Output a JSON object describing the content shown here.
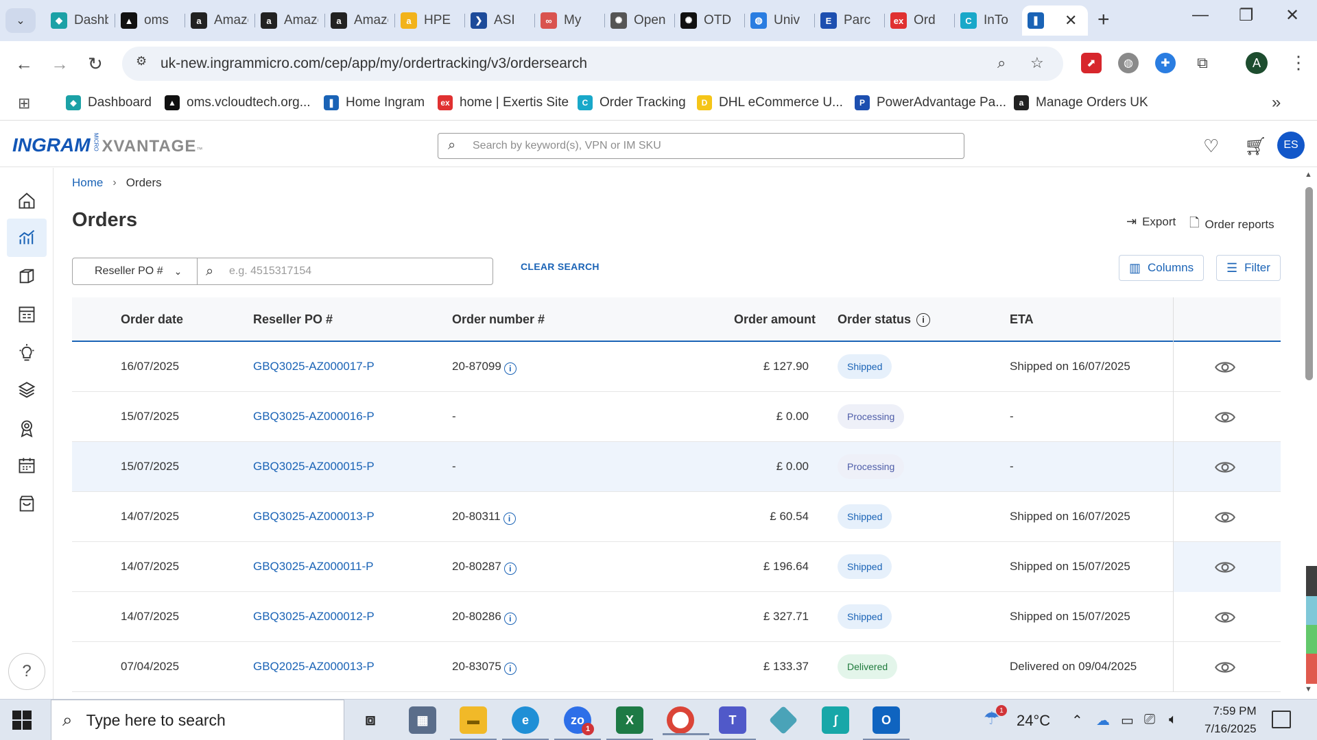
{
  "browser": {
    "tabs": [
      {
        "label": "Dashboard",
        "fav_color": "#1ba1a6",
        "fav_glyph": "◆"
      },
      {
        "label": "oms",
        "fav_color": "#111111",
        "fav_glyph": "▲"
      },
      {
        "label": "Amazon",
        "fav_color": "#222222",
        "fav_glyph": "a"
      },
      {
        "label": "Amazon",
        "fav_color": "#222222",
        "fav_glyph": "a"
      },
      {
        "label": "Amazon",
        "fav_color": "#222222",
        "fav_glyph": "a"
      },
      {
        "label": "HPE",
        "fav_color": "#f2b31b",
        "fav_glyph": "a"
      },
      {
        "label": "ASI",
        "fav_color": "#1d4b9a",
        "fav_glyph": "❯"
      },
      {
        "label": "My",
        "fav_color": "#d9534f",
        "fav_glyph": "∞"
      },
      {
        "label": "Open",
        "fav_color": "#555555",
        "fav_glyph": "✺"
      },
      {
        "label": "OTD",
        "fav_color": "#111111",
        "fav_glyph": "✺"
      },
      {
        "label": "Univ",
        "fav_color": "#2a7de1",
        "fav_glyph": "◍"
      },
      {
        "label": "Parc",
        "fav_color": "#1d4fb0",
        "fav_glyph": "E"
      },
      {
        "label": "Ord",
        "fav_color": "#e03131",
        "fav_glyph": "ex"
      },
      {
        "label": "InTo",
        "fav_color": "#19a8c9",
        "fav_glyph": "C"
      }
    ],
    "active_tab_fav_color": "#1a63b6",
    "url": "uk-new.ingrammicro.com/cep/app/my/ordertracking/v3/ordersearch",
    "profile_initial": "A",
    "bookmarks": [
      {
        "label": "Dashboard",
        "color": "#1ba1a6",
        "glyph": "◆"
      },
      {
        "label": "oms.vcloudtech.org...",
        "color": "#111111",
        "glyph": "▲"
      },
      {
        "label": "Home Ingram",
        "color": "#1a63b6",
        "glyph": "❚"
      },
      {
        "label": "home | Exertis Site",
        "color": "#e03131",
        "glyph": "ex"
      },
      {
        "label": "Order Tracking",
        "color": "#19a8c9",
        "glyph": "C"
      },
      {
        "label": "DHL eCommerce U...",
        "color": "#f5c518",
        "glyph": "D"
      },
      {
        "label": "PowerAdvantage Pa...",
        "color": "#1d4fb0",
        "glyph": "P"
      },
      {
        "label": "Manage Orders UK",
        "color": "#222222",
        "glyph": "a"
      }
    ]
  },
  "header": {
    "logo_main": "INGRAM",
    "logo_micro": "MICRO",
    "logo_sub": "XVANTAGE",
    "search_placeholder": "Search by keyword(s), VPN or IM SKU",
    "user_initials": "ES"
  },
  "breadcrumb": {
    "home": "Home",
    "current": "Orders"
  },
  "page": {
    "title": "Orders",
    "export_label": "Export",
    "reports_label": "Order reports",
    "search_field_select": "Reseller PO #",
    "search_placeholder": "e.g. 4515317154",
    "clear_label": "CLEAR SEARCH",
    "columns_label": "Columns",
    "filter_label": "Filter"
  },
  "table": {
    "headers": {
      "date": "Order date",
      "po": "Reseller PO #",
      "number": "Order number #",
      "amount": "Order amount",
      "status": "Order status",
      "eta": "ETA"
    },
    "rows": [
      {
        "date": "16/07/2025",
        "po": "GBQ3025-AZ000017-P",
        "number": "20-87099",
        "has_info": true,
        "amount": "£ 127.90",
        "status": "Shipped",
        "status_kind": "shipped",
        "eta": "Shipped on 16/07/2025"
      },
      {
        "date": "15/07/2025",
        "po": "GBQ3025-AZ000016-P",
        "number": "-",
        "has_info": false,
        "amount": "£ 0.00",
        "status": "Processing",
        "status_kind": "processing",
        "eta": "-"
      },
      {
        "date": "15/07/2025",
        "po": "GBQ3025-AZ000015-P",
        "number": "-",
        "has_info": false,
        "amount": "£ 0.00",
        "status": "Processing",
        "status_kind": "processing",
        "eta": "-"
      },
      {
        "date": "14/07/2025",
        "po": "GBQ3025-AZ000013-P",
        "number": "20-80311",
        "has_info": true,
        "amount": "£ 60.54",
        "status": "Shipped",
        "status_kind": "shipped",
        "eta": "Shipped on 16/07/2025"
      },
      {
        "date": "14/07/2025",
        "po": "GBQ3025-AZ000011-P",
        "number": "20-80287",
        "has_info": true,
        "amount": "£ 196.64",
        "status": "Shipped",
        "status_kind": "shipped",
        "eta": "Shipped on 15/07/2025"
      },
      {
        "date": "14/07/2025",
        "po": "GBQ3025-AZ000012-P",
        "number": "20-80286",
        "has_info": true,
        "amount": "£ 327.71",
        "status": "Shipped",
        "status_kind": "shipped",
        "eta": "Shipped on 15/07/2025"
      },
      {
        "date": "07/04/2025",
        "po": "GBQ2025-AZ000013-P",
        "number": "20-83075",
        "has_info": true,
        "amount": "£ 133.37",
        "status": "Delivered",
        "status_kind": "delivered",
        "eta": "Delivered on 09/04/2025"
      }
    ]
  },
  "taskbar": {
    "search_placeholder": "Type here to search",
    "weather_temp": "24°C",
    "weather_badge": "1",
    "zoom_badge": "1",
    "time": "7:59 PM",
    "date": "7/16/2025"
  }
}
